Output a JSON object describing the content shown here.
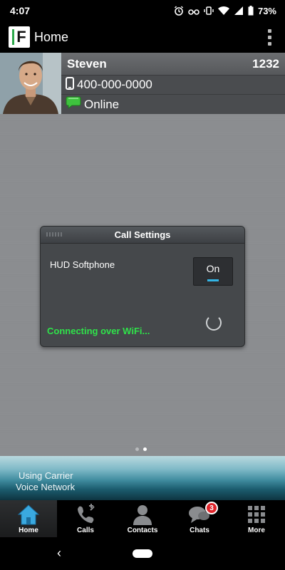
{
  "status_bar": {
    "time": "4:07",
    "battery": "73%",
    "icons": [
      "alarm-icon",
      "bluetooth-icon",
      "vibrate-icon",
      "wifi-icon",
      "signal-icon",
      "battery-icon"
    ]
  },
  "app_bar": {
    "logo_letter": "F",
    "title": "Home",
    "overflow_icon": "more-vert-icon"
  },
  "profile": {
    "name": "Steven",
    "extension": "1232",
    "phone": "400-000-0000",
    "presence": "Online",
    "presence_color": "#3ec23e"
  },
  "dialog": {
    "title": "Call Settings",
    "setting_label": "HUD Softphone",
    "toggle_value": "On",
    "connection_status": "Connecting over WiFi...",
    "status_color": "#2fe24a",
    "accent_color": "#33b5e5"
  },
  "pager": {
    "pages": 2,
    "current": 2
  },
  "carrier": {
    "line1": "Using Carrier",
    "line2": "Voice Network"
  },
  "tabs": [
    {
      "label": "Home",
      "icon": "home-icon",
      "active": true
    },
    {
      "label": "Calls",
      "icon": "phone-calls-icon",
      "active": false
    },
    {
      "label": "Contacts",
      "icon": "contacts-icon",
      "active": false
    },
    {
      "label": "Chats",
      "icon": "chat-bubbles-icon",
      "active": false,
      "badge": "3"
    },
    {
      "label": "More",
      "icon": "grid-icon",
      "active": false
    }
  ],
  "nav_bar": {
    "back_glyph": "‹"
  }
}
